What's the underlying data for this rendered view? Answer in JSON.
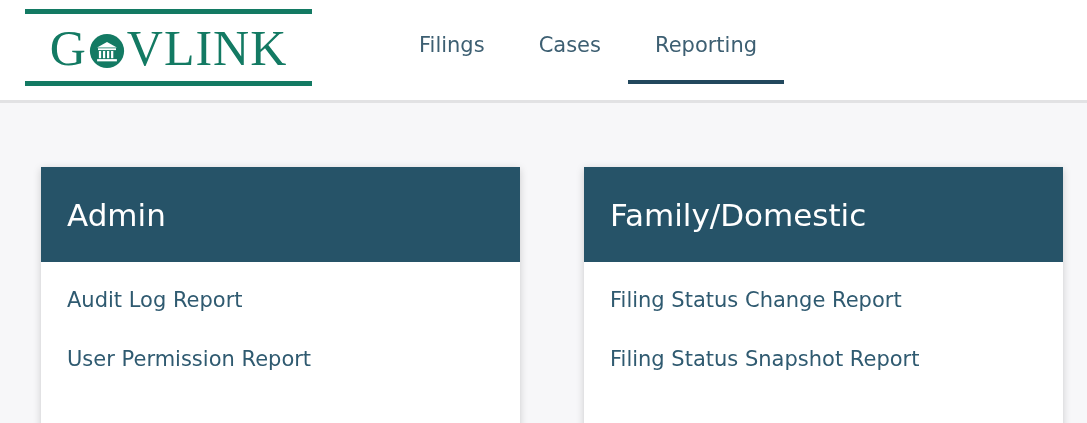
{
  "logo": {
    "first_letter": "G",
    "rest": "VLINK"
  },
  "nav": [
    {
      "label": "Filings",
      "selected": false
    },
    {
      "label": "Cases",
      "selected": false
    },
    {
      "label": "Reporting",
      "selected": true
    }
  ],
  "cards": [
    {
      "title": "Admin",
      "links": [
        "Audit Log Report",
        "User Permission Report"
      ]
    },
    {
      "title": "Family/Domestic",
      "links": [
        "Filing Status Change Report",
        "Filing Status Snapshot Report"
      ]
    }
  ]
}
